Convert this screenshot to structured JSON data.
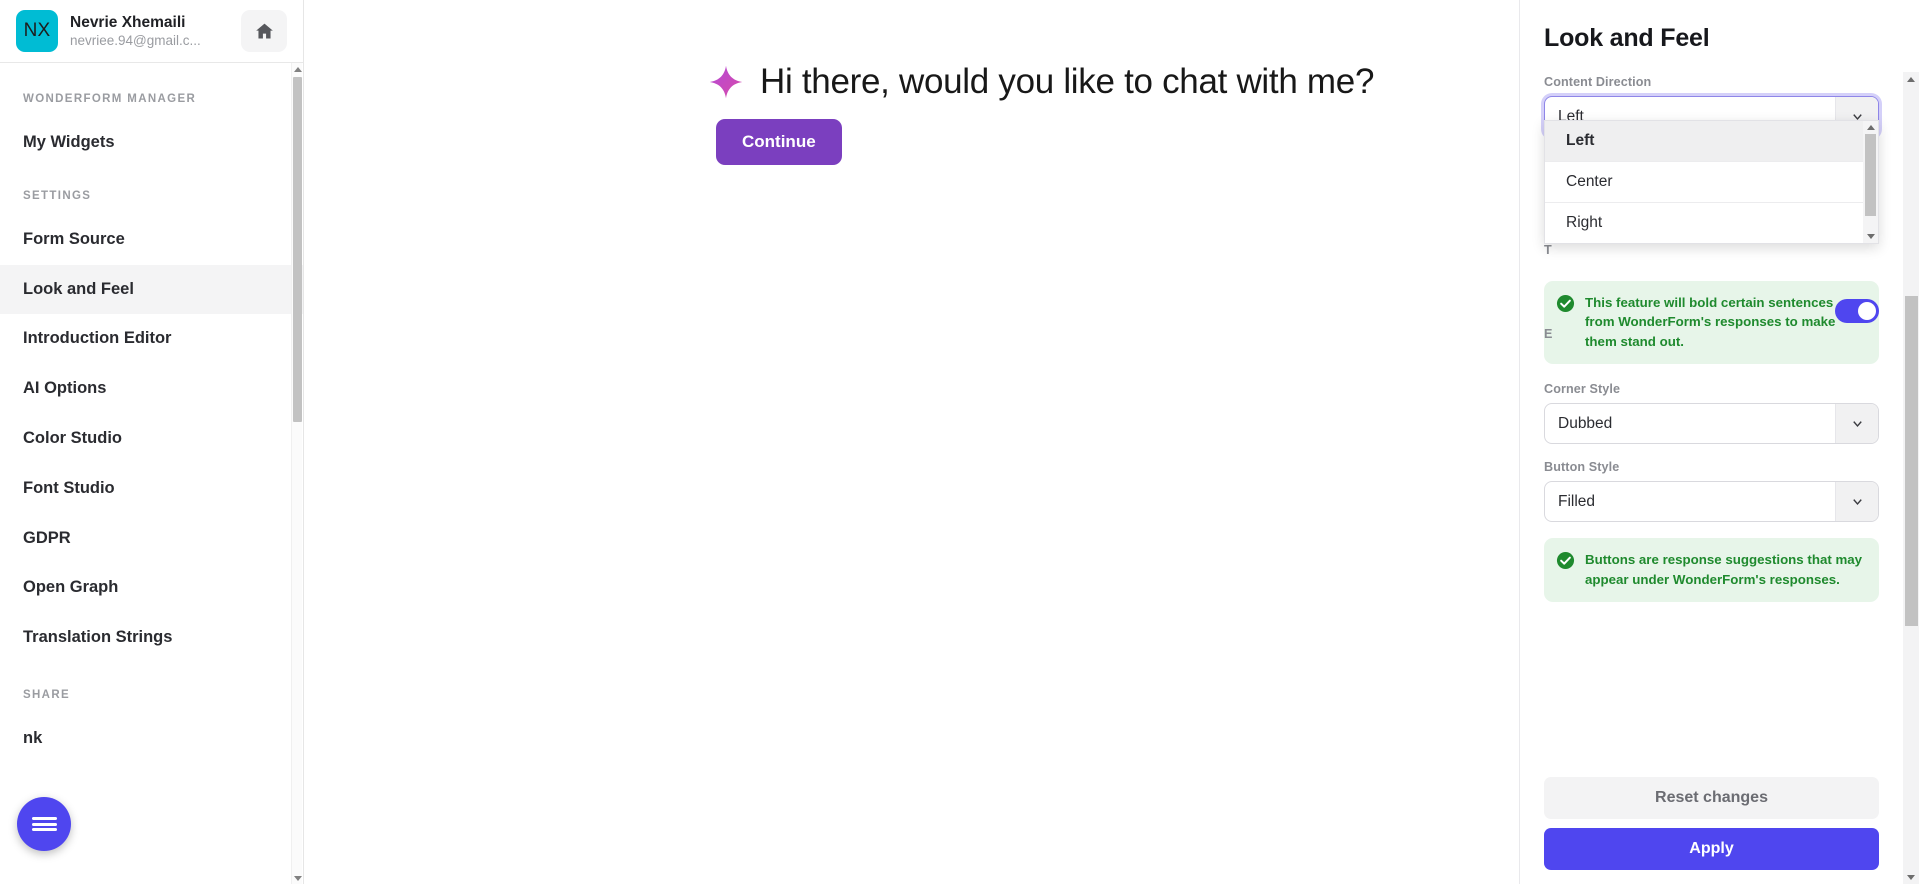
{
  "sidebar": {
    "user": {
      "initials": "NX",
      "name": "Nevrie Xhemaili",
      "email": "nevriee.94@gmail.c..."
    },
    "home_icon": "home-icon",
    "sections": [
      {
        "title": "WONDERFORM MANAGER",
        "items": [
          {
            "label": "My Widgets",
            "active": false
          }
        ]
      },
      {
        "title": "SETTINGS",
        "items": [
          {
            "label": "Form Source",
            "active": false
          },
          {
            "label": "Look and Feel",
            "active": true
          },
          {
            "label": "Introduction Editor",
            "active": false
          },
          {
            "label": "AI Options",
            "active": false
          },
          {
            "label": "Color Studio",
            "active": false
          },
          {
            "label": "Font Studio",
            "active": false
          },
          {
            "label": "GDPR",
            "active": false
          },
          {
            "label": "Open Graph",
            "active": false
          },
          {
            "label": "Translation Strings",
            "active": false
          }
        ]
      },
      {
        "title": "SHARE",
        "items": [
          {
            "label": "nk",
            "active": false
          }
        ]
      }
    ],
    "menu_fab": "hamburger-menu-icon"
  },
  "preview": {
    "sparkle_icon": "sparkle-icon",
    "greeting": "Hi there, would you like to chat with me?",
    "continue_label": "Continue",
    "continue_color": "#7b3fbf",
    "sparkle_color": "#c84bc8"
  },
  "panel": {
    "title": "Look and Feel",
    "content_direction": {
      "label": "Content Direction",
      "value": "Left",
      "options": [
        "Left",
        "Center",
        "Right"
      ],
      "expanded": true,
      "focus_ring_color": "#8f86e8"
    },
    "hidden_label_1": "T",
    "hidden_label_2": "E",
    "alert_bold": {
      "icon": "check-circle-icon",
      "text": "This feature will bold certain sentences from WonderForm's responses to make them stand out.",
      "color": "#1f8a2e",
      "background": "#e7f5e9"
    },
    "corner_style": {
      "label": "Corner Style",
      "value": "Dubbed"
    },
    "button_style": {
      "label": "Button Style",
      "value": "Filled"
    },
    "alert_buttons": {
      "icon": "check-circle-icon",
      "text": "Buttons are response suggestions that may appear under WonderForm's responses.",
      "color": "#1f8a2e",
      "background": "#e7f5e9"
    },
    "reset_label": "Reset changes",
    "apply_label": "Apply",
    "apply_color": "#4f46ef"
  },
  "annotation": {
    "arrow_color": "#ee1111",
    "arrow_target": "content-direction-select"
  }
}
